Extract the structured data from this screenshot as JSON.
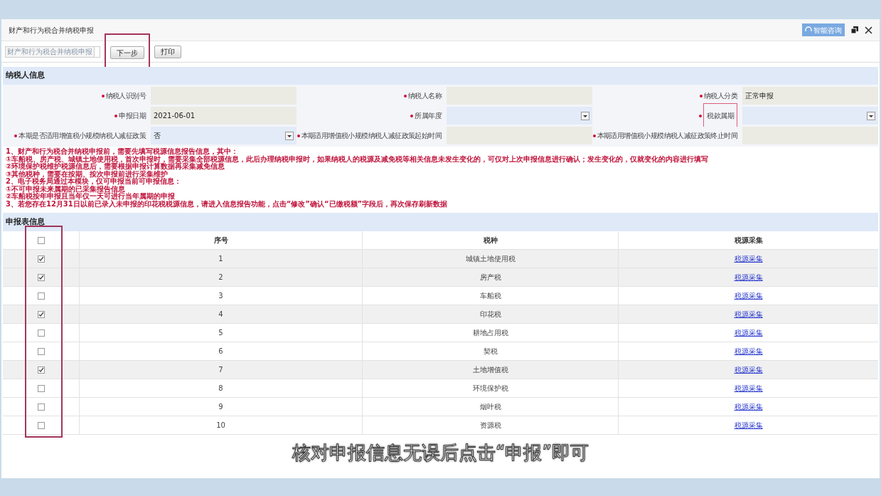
{
  "window": {
    "title": "财产和行为税合并纳税申报",
    "help_button": "智能咨询"
  },
  "toolbar": {
    "form_select": "财产和行为税合并纳税申报",
    "buttons": [
      {
        "label": "下一步",
        "annotated": true
      },
      {
        "label": "打印",
        "annotated": false
      }
    ]
  },
  "taxpayer_section": {
    "title": "纳税人信息",
    "fields": [
      {
        "label": "纳税人识别号",
        "kind": "text",
        "annotated": false
      },
      {
        "label": "纳税人名称",
        "kind": "text",
        "annotated": false
      },
      {
        "label": "纳税人分类",
        "kind": "text",
        "value": "正常申报",
        "annotated": false
      },
      {
        "label": "申报日期",
        "kind": "text",
        "value": "2021-06-01",
        "annotated": false
      },
      {
        "label": "所属年度",
        "kind": "select",
        "annotated": false
      },
      {
        "label": "税款属期",
        "kind": "select",
        "annotated": true
      },
      {
        "label": "本期是否适用增值税小规模纳税人减征政策",
        "kind": "select",
        "value": "否",
        "annotated": false
      },
      {
        "label": "本期适用增值税小规模纳税人减征政策起始时间",
        "kind": "text",
        "annotated": false
      },
      {
        "label": "本期适用增值税小规模纳税人减征政策终止时间",
        "kind": "text",
        "annotated": false
      }
    ],
    "notice": [
      "1、财产和行为税合并纳税申报前，需要先填写税源信息报告信息，其中：",
      "①车船税、房产税、城镇土地使用税，首次申报时，需要采集全部税源信息，此后办理纳税申报时，如果纳税人的税源及减免税等相关信息未发生变化的，可仅对上次申报信息进行确认；发生变化的，仅就变化的内容进行填写",
      "②环境保护税维护税源信息后，需要根据申报计算数据再采集减免信息",
      "③其他税种，需要在按期、按次申报前进行采集维护",
      "2、电子税务局通过本模块，仅可申报当前可申报信息：",
      "①不可申报未来属期的已采集报告信息",
      "②车船税按年申报且当年仅一天可进行当年属期的申报",
      "3、若您存在12月31日以前已录入未申报的印花税税源信息，请进入信息报告功能，点击“修改”确认“已缴税额”字段后，再次保存刷新数据"
    ]
  },
  "declaration_section": {
    "title": "申报表信息",
    "checkbox_column_annotated": true,
    "columns": [
      "序号",
      "税种",
      "税源采集"
    ],
    "header_checked": false,
    "rows": [
      {
        "no": "1",
        "tax": "城镇土地使用税",
        "link": "税源采集",
        "checked": true
      },
      {
        "no": "2",
        "tax": "房产税",
        "link": "税源采集",
        "checked": true
      },
      {
        "no": "3",
        "tax": "车船税",
        "link": "税源采集",
        "checked": false
      },
      {
        "no": "4",
        "tax": "印花税",
        "link": "税源采集",
        "checked": true
      },
      {
        "no": "5",
        "tax": "耕地占用税",
        "link": "税源采集",
        "checked": false
      },
      {
        "no": "6",
        "tax": "契税",
        "link": "税源采集",
        "checked": false
      },
      {
        "no": "7",
        "tax": "土地增值税",
        "link": "税源采集",
        "checked": true
      },
      {
        "no": "8",
        "tax": "环境保护税",
        "link": "税源采集",
        "checked": false
      },
      {
        "no": "9",
        "tax": "烟叶税",
        "link": "税源采集",
        "checked": false
      },
      {
        "no": "10",
        "tax": "资源税",
        "link": "税源采集",
        "checked": false
      }
    ]
  },
  "subtitle": "核对申报信息无误后点击“申报”即可"
}
